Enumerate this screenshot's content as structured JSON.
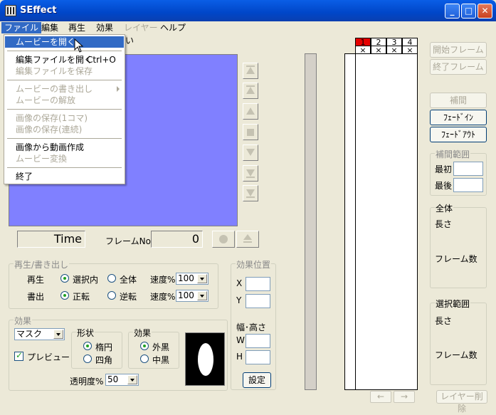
{
  "window": {
    "title": "SEffect"
  },
  "menubar": {
    "file": "ファイル",
    "edit": "編集",
    "play": "再生",
    "effect": "効果",
    "layer": "レイヤー",
    "help": "ヘルプ"
  },
  "file_menu": {
    "open_movie": "ムービーを開く",
    "open_edit": "編集ファイルを開く",
    "open_edit_shortcut": "Ctrl+O",
    "save_edit": "編集ファイルを保存",
    "export_movie": "ムービーの書き出し",
    "release_movie": "ムービーの解放",
    "save_image_one": "画像の保存(1コマ)",
    "save_image_seq": "画像の保存(連続)",
    "make_from_images": "画像から動画作成",
    "convert_movie": "ムービー変換",
    "quit": "終了"
  },
  "behind_menu_text": "い",
  "transport": {
    "time_label": "Time",
    "frame_label": "フレームNo.",
    "frame_value": "0"
  },
  "playback": {
    "group": "再生/書き出し",
    "play_label": "再生",
    "selection": "選択内",
    "all": "全体",
    "speed_label": "速度%",
    "speed_play": "100",
    "write_label": "書出",
    "forward": "正転",
    "reverse": "逆転",
    "speed_write": "100"
  },
  "effect_position": {
    "group": "効果位置",
    "x": "X",
    "y": "Y",
    "size_label": "幅･高さ",
    "w": "W",
    "h": "H",
    "settings": "設定"
  },
  "effect": {
    "group": "効果",
    "type_value": "マスク",
    "preview": "プレビュー",
    "shape_group": "形状",
    "ellipse": "楕円",
    "rect": "四角",
    "effect_group": "効果",
    "outer": "外黒",
    "inner": "中黒",
    "opacity_label": "透明度%",
    "opacity_value": "50"
  },
  "layers": {
    "headers": [
      "1",
      "2",
      "3",
      "4"
    ],
    "marks": [
      "×",
      "×",
      "×",
      "×"
    ],
    "prev": "←",
    "next": "→",
    "delete_layer": "レイヤー削除"
  },
  "right_panel": {
    "start_frame": "開始フレーム",
    "end_frame": "終了フレーム",
    "interpolate": "補間",
    "fade_in": "ﾌｪｰﾄﾞｲﾝ",
    "fade_out": "ﾌｪｰﾄﾞｱｳﾄ",
    "interp_range": "補間範囲",
    "first": "最初",
    "last": "最後",
    "all_group": "全体",
    "length": "長さ",
    "frames": "フレーム数",
    "sel_group": "選択範囲",
    "sel_length": "長さ",
    "sel_frames": "フレーム数"
  },
  "colors": {
    "titlebar": "#0A5EE6",
    "preview": "#8080FF",
    "menu_highlight": "#316AC5",
    "layer_active": "#E50000"
  }
}
